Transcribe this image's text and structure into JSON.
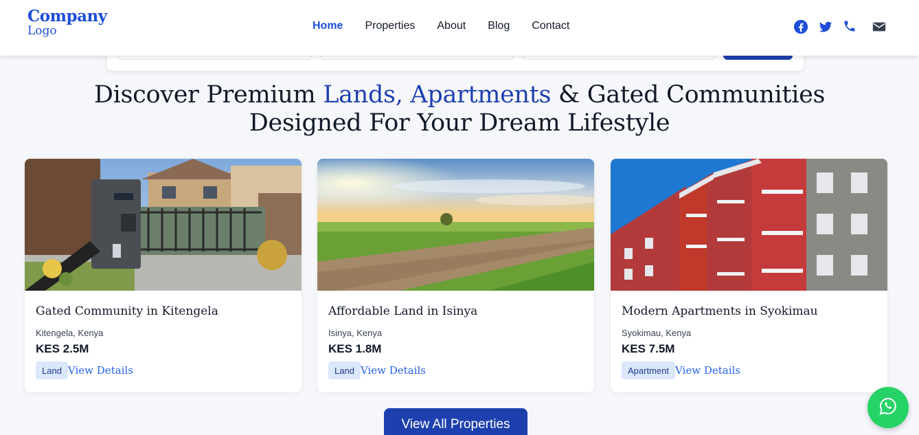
{
  "header": {
    "logo_line1": "Company",
    "logo_line2": "Logo",
    "nav": [
      "Home",
      "Properties",
      "About",
      "Blog",
      "Contact"
    ],
    "active_nav": "Home",
    "social_icons": [
      "facebook-icon",
      "twitter-icon",
      "phone-icon",
      "email-icon"
    ]
  },
  "heading": {
    "part1": "Discover Premium ",
    "highlight": "Lands, Apartments",
    "part2": " & Gated Communities",
    "line2": "Designed For Your Dream Lifestyle"
  },
  "properties": [
    {
      "title": "Gated Community in Kitengela",
      "location": "Kitengela, Kenya",
      "price": "KES 2.5M",
      "badge": "Land",
      "link": "View Details"
    },
    {
      "title": "Affordable Land in Isinya",
      "location": "Isinya, Kenya",
      "price": "KES 1.8M",
      "badge": "Land",
      "link": "View Details"
    },
    {
      "title": "Modern Apartments in Syokimau",
      "location": "Syokimau, Kenya",
      "price": "KES 7.5M",
      "badge": "Apartment",
      "link": "View Details"
    }
  ],
  "cta_label": "View All Properties",
  "colors": {
    "brand": "#1e40af",
    "link": "#2563eb",
    "whatsapp": "#25d366"
  }
}
